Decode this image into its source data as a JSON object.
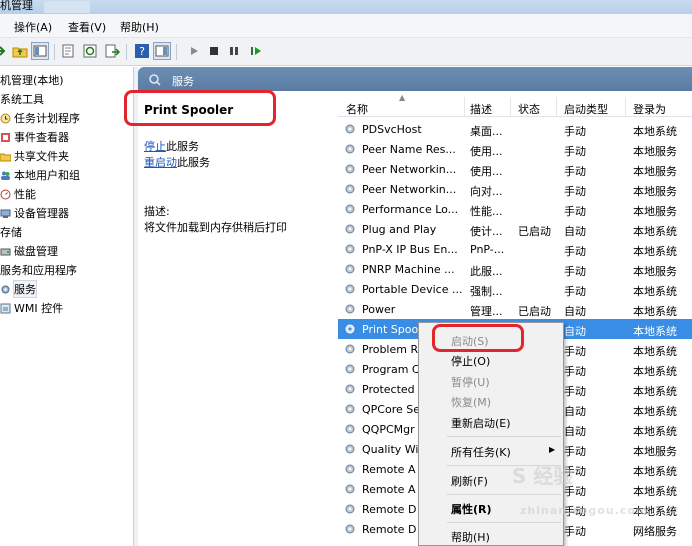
{
  "window": {
    "title_partial": "机管理"
  },
  "menu": {
    "action": "操作(A)",
    "view": "查看(V)",
    "help": "帮助(H)"
  },
  "tree": {
    "items": [
      {
        "label": "机管理(本地)",
        "indent": 0
      },
      {
        "label": "系统工具",
        "indent": 0
      },
      {
        "label": "任务计划程序",
        "indent": 1
      },
      {
        "label": "事件查看器",
        "indent": 1
      },
      {
        "label": "共享文件夹",
        "indent": 1
      },
      {
        "label": "本地用户和组",
        "indent": 1
      },
      {
        "label": "性能",
        "indent": 1
      },
      {
        "label": "设备管理器",
        "indent": 1
      },
      {
        "label": "存储",
        "indent": 0
      },
      {
        "label": "磁盘管理",
        "indent": 1
      },
      {
        "label": "服务和应用程序",
        "indent": 0
      },
      {
        "label": "服务",
        "indent": 1
      },
      {
        "label": "WMI 控件",
        "indent": 1
      }
    ]
  },
  "main": {
    "header_title": "服务"
  },
  "detail": {
    "service_name": "Print Spooler",
    "stop_link": "停止",
    "stop_suffix": "此服务",
    "restart_link": "重启动",
    "restart_suffix": "此服务",
    "desc_label": "描述:",
    "desc_text": "将文件加载到内存供稍后打印"
  },
  "columns": {
    "name": "名称",
    "desc": "描述",
    "status": "状态",
    "startup": "启动类型",
    "logon": "登录为"
  },
  "rows": [
    {
      "name": "PDSvcHost",
      "desc": "桌面...",
      "status": "",
      "startup": "手动",
      "logon": "本地系统"
    },
    {
      "name": "Peer Name Res...",
      "desc": "使用...",
      "status": "",
      "startup": "手动",
      "logon": "本地服务"
    },
    {
      "name": "Peer Networkin...",
      "desc": "使用...",
      "status": "",
      "startup": "手动",
      "logon": "本地服务"
    },
    {
      "name": "Peer Networkin...",
      "desc": "向对...",
      "status": "",
      "startup": "手动",
      "logon": "本地服务"
    },
    {
      "name": "Performance Lo...",
      "desc": "性能...",
      "status": "",
      "startup": "手动",
      "logon": "本地服务"
    },
    {
      "name": "Plug and Play",
      "desc": "使计...",
      "status": "已启动",
      "startup": "自动",
      "logon": "本地系统"
    },
    {
      "name": "PnP-X IP Bus En...",
      "desc": "PnP-...",
      "status": "",
      "startup": "手动",
      "logon": "本地系统"
    },
    {
      "name": "PNRP Machine ...",
      "desc": "此服...",
      "status": "",
      "startup": "手动",
      "logon": "本地服务"
    },
    {
      "name": "Portable Device ...",
      "desc": "强制...",
      "status": "",
      "startup": "手动",
      "logon": "本地系统"
    },
    {
      "name": "Power",
      "desc": "管理...",
      "status": "已启动",
      "startup": "自动",
      "logon": "本地系统"
    },
    {
      "name": "Print Spoo",
      "desc": "",
      "status": "",
      "startup": "自动",
      "logon": "本地系统"
    },
    {
      "name": "Problem R",
      "desc": "",
      "status": "",
      "startup": "手动",
      "logon": "本地系统"
    },
    {
      "name": "Program C",
      "desc": "",
      "status": "",
      "startup": "手动",
      "logon": "本地系统"
    },
    {
      "name": "Protected",
      "desc": "",
      "status": "",
      "startup": "手动",
      "logon": "本地系统"
    },
    {
      "name": "QPCore Se",
      "desc": "",
      "status": "",
      "startup": "自动",
      "logon": "本地系统"
    },
    {
      "name": "QQPCMgr",
      "desc": "",
      "status": "",
      "startup": "自动",
      "logon": "本地系统"
    },
    {
      "name": "Quality Wi",
      "desc": "",
      "status": "",
      "startup": "手动",
      "logon": "本地服务"
    },
    {
      "name": "Remote A",
      "desc": "",
      "status": "",
      "startup": "手动",
      "logon": "本地系统"
    },
    {
      "name": "Remote A",
      "desc": "",
      "status": "",
      "startup": "手动",
      "logon": "本地系统"
    },
    {
      "name": "Remote D",
      "desc": "",
      "status": "",
      "startup": "手动",
      "logon": "本地系统"
    },
    {
      "name": "Remote D",
      "desc": "",
      "status": "",
      "startup": "手动",
      "logon": "网络服务"
    }
  ],
  "context_menu": {
    "start": "启动(S)",
    "stop": "停止(O)",
    "pause": "暂停(U)",
    "resume": "恢复(M)",
    "restart": "重新启动(E)",
    "all_tasks": "所有任务(K)",
    "refresh": "刷新(F)",
    "properties": "属性(R)",
    "help": "帮助(H)"
  },
  "watermark": {
    "main": "S 经验",
    "sub": "zhinan.sogou.com"
  },
  "colors": {
    "selection": "#3a8de4",
    "callout": "#e3252f",
    "link": "#1b57b8"
  }
}
